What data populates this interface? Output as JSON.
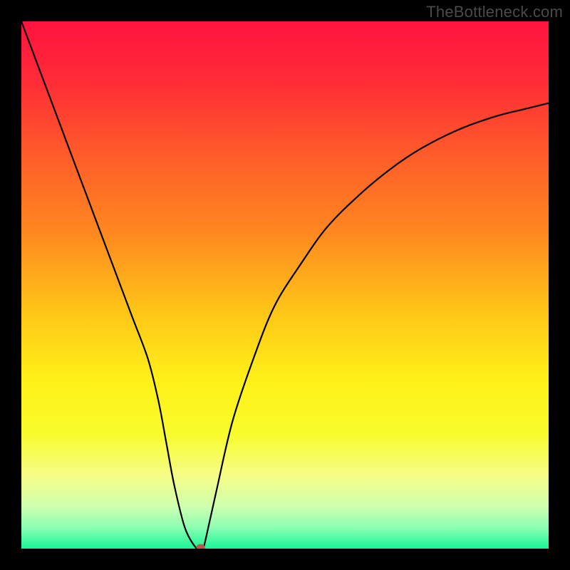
{
  "watermark": "TheBottleneck.com",
  "chart_data": {
    "type": "line",
    "title": "",
    "xlabel": "",
    "ylabel": "",
    "xlim": [
      0,
      100
    ],
    "ylim": [
      0,
      100
    ],
    "grid": false,
    "background_gradient": {
      "stops": [
        {
          "offset": 0.0,
          "color": "#ff123f"
        },
        {
          "offset": 0.12,
          "color": "#ff2e36"
        },
        {
          "offset": 0.25,
          "color": "#ff5a2a"
        },
        {
          "offset": 0.4,
          "color": "#ff8820"
        },
        {
          "offset": 0.55,
          "color": "#ffc518"
        },
        {
          "offset": 0.68,
          "color": "#fff018"
        },
        {
          "offset": 0.78,
          "color": "#f8fb2a"
        },
        {
          "offset": 0.86,
          "color": "#f6fd85"
        },
        {
          "offset": 0.92,
          "color": "#cfffb0"
        },
        {
          "offset": 0.96,
          "color": "#8bffb2"
        },
        {
          "offset": 1.0,
          "color": "#19f597"
        }
      ]
    },
    "series": [
      {
        "name": "bottleneck-curve",
        "color": "#000000",
        "x": [
          0,
          3,
          6,
          9,
          12,
          15,
          18,
          21,
          24,
          26,
          27.5,
          29,
          31,
          33,
          34,
          34.5,
          35,
          37,
          40,
          44,
          48,
          53,
          58,
          64,
          70,
          76,
          83,
          90,
          96,
          100
        ],
        "y": [
          100,
          92,
          84,
          76,
          68,
          60,
          52,
          44,
          36,
          28,
          20,
          12,
          4,
          0.3,
          0.2,
          0.2,
          2,
          11,
          24,
          36,
          46,
          54,
          61,
          67,
          72,
          76,
          79.5,
          82,
          83.5,
          84.5
        ]
      }
    ],
    "marker": {
      "name": "optimal-point",
      "x": 34,
      "y": 0.2,
      "color": "#b35b4e"
    }
  }
}
